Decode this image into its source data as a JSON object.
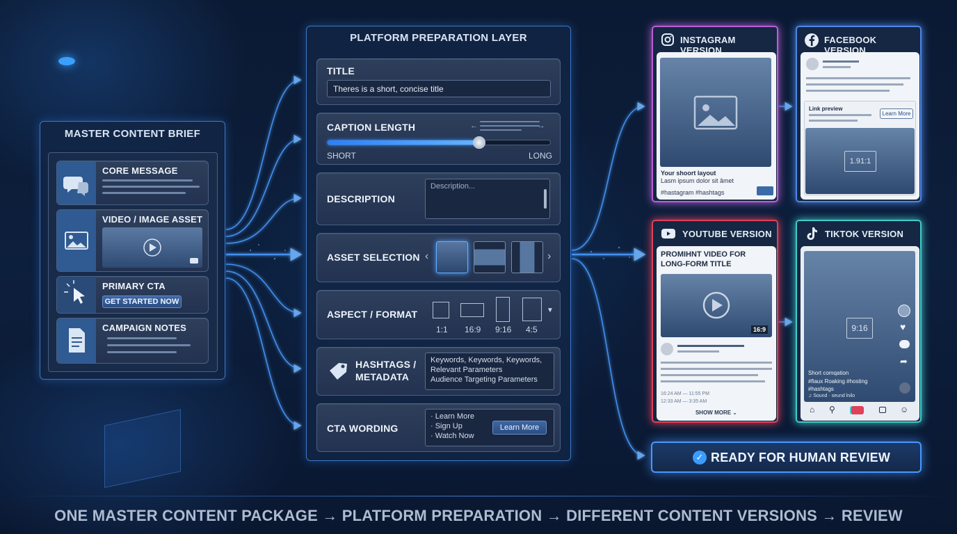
{
  "master": {
    "title": "MASTER CONTENT BRIEF",
    "items": [
      {
        "label": "CORE MESSAGE",
        "icon": "speech-bubbles-icon"
      },
      {
        "label": "VIDEO / IMAGE ASSET",
        "icon": "image-icon"
      },
      {
        "label": "PRIMARY CTA",
        "icon": "cursor-click-icon",
        "button": "GET STARTED NOW"
      },
      {
        "label": "CAMPAIGN NOTES",
        "icon": "document-icon"
      }
    ]
  },
  "prep": {
    "title": "PLATFORM PREPARATION LAYER",
    "title_section": {
      "label": "TITLE",
      "value": "Theres is a short, concise title"
    },
    "caption": {
      "label": "CAPTION LENGTH",
      "min_label": "SHORT",
      "max_label": "LONG",
      "level": 0.68
    },
    "description": {
      "label": "DESCRIPTION",
      "placeholder": "Description..."
    },
    "asset": {
      "label": "ASSET SELECTION"
    },
    "aspect": {
      "label": "ASPECT / FORMAT",
      "options": [
        "1:1",
        "16:9",
        "9:16",
        "4:5"
      ]
    },
    "hashtags": {
      "label_line1": "HASHTAGS /",
      "label_line2": "METADATA",
      "lines": [
        "Keywords, Keywords, Keywords,",
        "Relevant Parameters",
        "Audience Targeting Parameters"
      ]
    },
    "cta": {
      "label": "CTA WORDING",
      "options": [
        "· Learn More",
        "· Sign Up",
        "· Watch Now"
      ],
      "button": "Learn More"
    }
  },
  "versions": {
    "instagram": {
      "title": "INSTAGRAM VERSION",
      "caption_title": "Your shoort layout",
      "caption_body": "Lasm ipsum dolor sit âmet",
      "hashtags": "#hastagram #hashtags",
      "color": "#b85fd6"
    },
    "facebook": {
      "title": "FACEBOOK VERSION",
      "link_preview": "Link preview",
      "button": "Learn More",
      "ratio": "1.91:1",
      "color": "#4d86e6"
    },
    "youtube": {
      "title": "YOUTUBE VERSION",
      "headline_line1": "PROMIHNT VIDEO FOR",
      "headline_line2": "LONG-FORM TITLE",
      "badge": "16:9",
      "time1": "16:24 AM — 11:55 PM",
      "time2": "12:33 AM — 3:35 AM",
      "show_more": "SHOW MORE ⌄",
      "color": "#e0405a"
    },
    "tiktok": {
      "title": "TIKTOK VERSION",
      "ratio": "9:16",
      "caption1": "Short comqation",
      "caption2": "#fiaux Roaking #hosting",
      "caption3": "#hashtags",
      "sound": "♫ Sound · seund lnilo",
      "color": "#43c9c9"
    }
  },
  "review": {
    "label": "READY FOR HUMAN REVIEW"
  },
  "footer": {
    "text": "ONE MASTER CONTENT PACKAGE → PLATFORM PREPARATION → DIFFERENT CONTENT VERSIONS → REVIEW"
  }
}
